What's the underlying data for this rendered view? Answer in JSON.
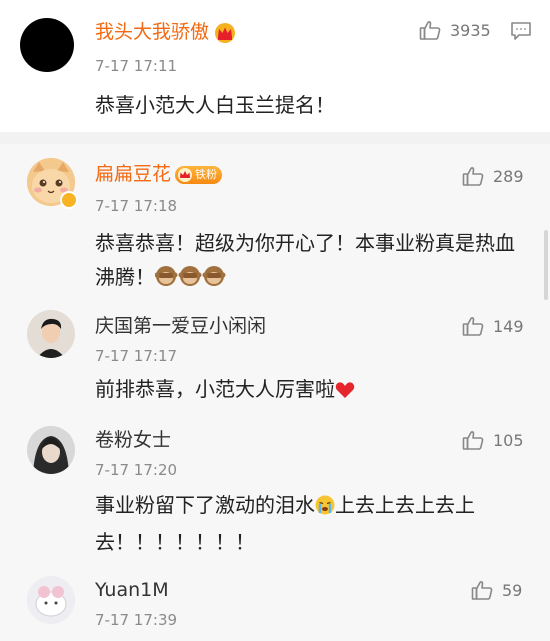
{
  "main_comment": {
    "username": "我头大我骄傲",
    "time": "7-17 17:11",
    "text": "恭喜小范大人白玉兰提名！",
    "likes": "3935"
  },
  "replies": [
    {
      "username": "扁扁豆花",
      "badge": "铁粉",
      "time": "7-17 17:18",
      "text": "恭喜恭喜！超级为你开心了！本事业粉真是热血沸腾！",
      "likes": "289"
    },
    {
      "username": "庆国第一爱豆小闲闲",
      "time": "7-17 17:17",
      "text": "前排恭喜，小范大人厉害啦",
      "likes": "149"
    },
    {
      "username": "卷粉女士",
      "time": "7-17 17:20",
      "text_line1": "事业粉留下了激动的泪水",
      "text_line1b": "上去上去上去上",
      "text_line2": "去！！！！！！！",
      "likes": "105"
    },
    {
      "username": "Yuan1M",
      "time": "7-17 17:39",
      "likes": "59"
    }
  ],
  "colors": {
    "username_highlight": "#f36a12",
    "timestamp": "#8a8a8a",
    "reply_background": "#f7f7f7"
  },
  "icons": [
    "thumbs-up-icon",
    "comment-icon",
    "crown-badge-icon",
    "monkey-emoji",
    "heart-emoji",
    "crying-emoji"
  ]
}
